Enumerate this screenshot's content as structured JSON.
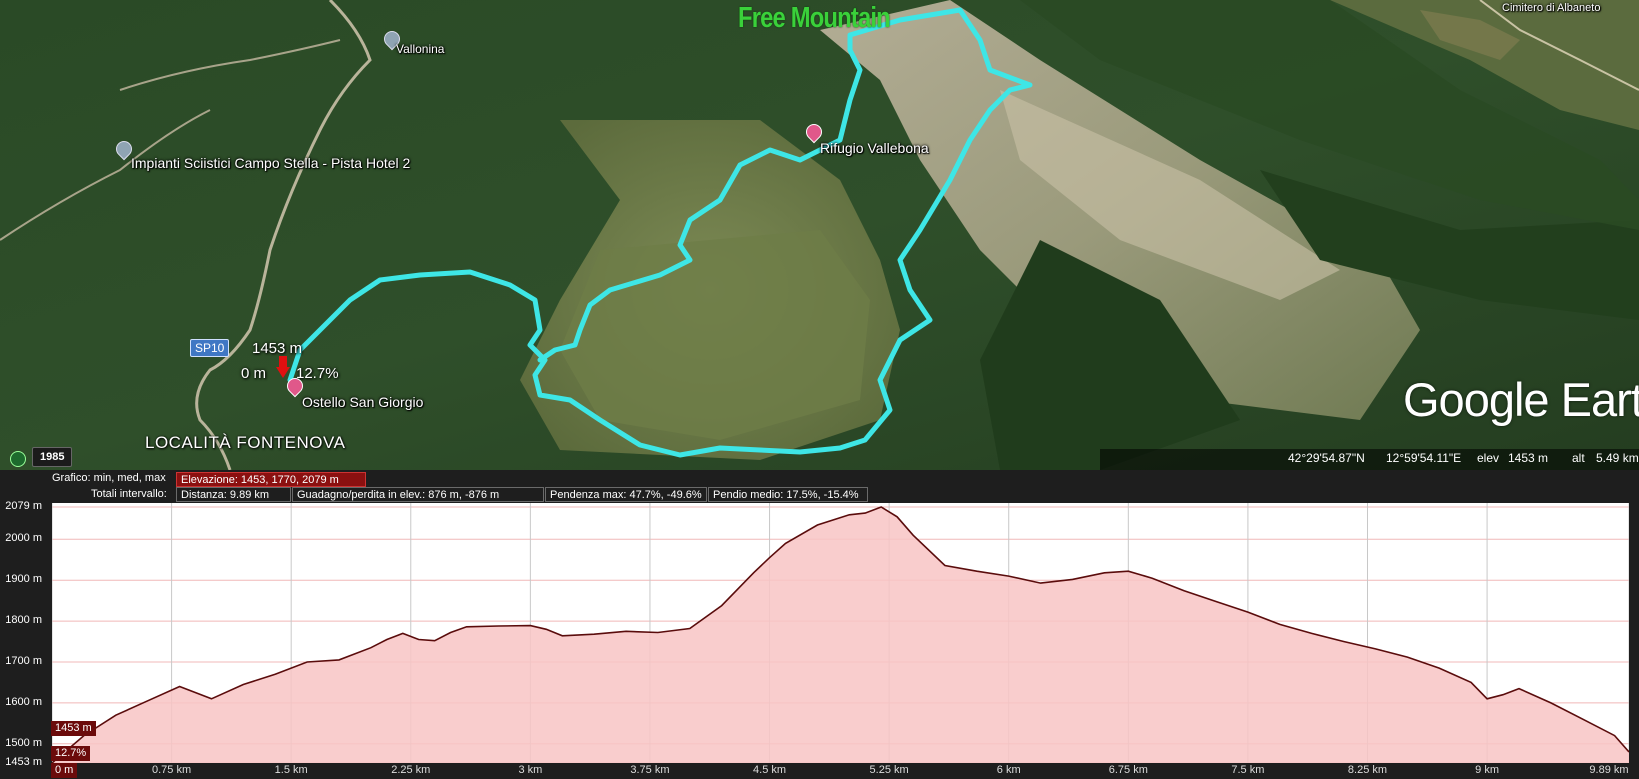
{
  "map": {
    "brand": "Free Mountain",
    "watermark": "Google Earth",
    "labels": {
      "vallonina": "Vallonina",
      "impianti": "Impianti Sciistici Campo Stella - Pista Hotel 2",
      "rifugio": "Rifugio Vallebona",
      "ostello": "Ostello San Giorgio",
      "cimitero": "Cimitero di Albaneto",
      "locality": "LOCALITÀ FONTENOVA",
      "road": "SP10"
    },
    "marker": {
      "elevation": "1453 m",
      "distance": "0 m",
      "grade": "12.7%"
    },
    "history_year": "1985",
    "status": {
      "lat": "42°29'54.87\"N",
      "lon": "12°59'54.11\"E",
      "elev_label": "elev",
      "elev": "1453 m",
      "alt_label": "alt",
      "alt": "5.49 km"
    },
    "track_color": "#3ee6e6"
  },
  "profile": {
    "row1": {
      "label": "Grafico: min, med, max",
      "elevation": "Elevazione: 1453, 1770, 2079 m"
    },
    "row2": {
      "label": "Totali intervallo:",
      "distance": "Distanza: 9.89 km",
      "gain": "Guadagno/perdita in elev.: 876 m, -876 m",
      "slope_max": "Pendenza max: 47.7%, -49.6%",
      "slope_avg": "Pendio medio: 17.5%, -15.4%"
    },
    "cursor": {
      "elevation": "1453 m",
      "grade": "12.7%",
      "distance": "0 m"
    }
  },
  "chart_data": {
    "type": "area",
    "title": "",
    "xlabel": "",
    "ylabel": "",
    "xlim": [
      0,
      9.89
    ],
    "ylim": [
      1453,
      2079
    ],
    "y_ticks": [
      "2079 m",
      "2000 m",
      "1900 m",
      "1800 m",
      "1700 m",
      "1600 m",
      "1500 m",
      "1453 m"
    ],
    "x_ticks": [
      "0 m",
      "0.75 km",
      "1.5 km",
      "2.25 km",
      "3 km",
      "3.75 km",
      "4.5 km",
      "5.25 km",
      "6 km",
      "6.75 km",
      "7.5 km",
      "8.25 km",
      "9 km",
      "9.89 km"
    ],
    "x_tick_values": [
      0,
      0.75,
      1.5,
      2.25,
      3,
      3.75,
      4.5,
      5.25,
      6,
      6.75,
      7.5,
      8.25,
      9,
      9.89
    ],
    "fill_color": "#f8c4c4",
    "line_color": "#5a0c0c",
    "series": [
      {
        "x": [
          0,
          0.2,
          0.4,
          0.6,
          0.8,
          1.0,
          1.2,
          1.4,
          1.6,
          1.8,
          2.0,
          2.1,
          2.2,
          2.3,
          2.4,
          2.5,
          2.6,
          2.8,
          3.0,
          3.1,
          3.2,
          3.4,
          3.6,
          3.8,
          4.0,
          4.2,
          4.4,
          4.5,
          4.6,
          4.8,
          5.0,
          5.1,
          5.2,
          5.3,
          5.4,
          5.6,
          5.8,
          6.0,
          6.2,
          6.4,
          6.6,
          6.75,
          6.9,
          7.1,
          7.3,
          7.5,
          7.7,
          7.9,
          8.1,
          8.3,
          8.5,
          8.7,
          8.9,
          9.0,
          9.1,
          9.2,
          9.4,
          9.6,
          9.8,
          9.89
        ],
        "y": [
          1453,
          1520,
          1570,
          1605,
          1640,
          1610,
          1645,
          1670,
          1700,
          1705,
          1735,
          1755,
          1770,
          1755,
          1752,
          1772,
          1786,
          1788,
          1789,
          1780,
          1764,
          1768,
          1775,
          1772,
          1782,
          1838,
          1918,
          1955,
          1990,
          2035,
          2060,
          2064,
          2079,
          2055,
          2010,
          1936,
          1922,
          1910,
          1893,
          1902,
          1918,
          1922,
          1905,
          1874,
          1848,
          1822,
          1792,
          1770,
          1750,
          1732,
          1712,
          1685,
          1650,
          1610,
          1620,
          1635,
          1600,
          1560,
          1520,
          1480
        ]
      }
    ],
    "grid": true
  }
}
